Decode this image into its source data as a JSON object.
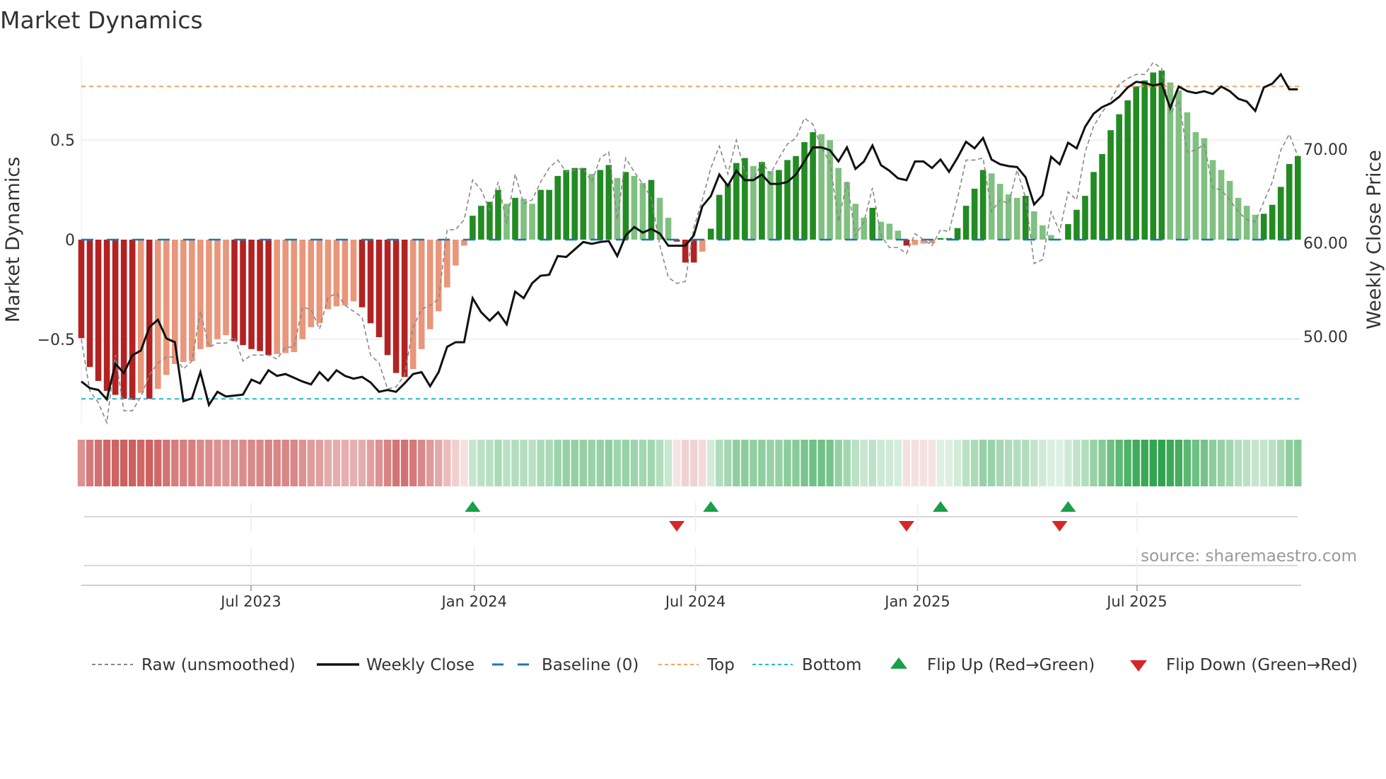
{
  "chart_data": {
    "type": "bar",
    "title": "Market Dynamics",
    "ylabel": "Market Dynamics",
    "ylabel_right": "Weekly Close Price",
    "ylim": [
      -0.92,
      0.92
    ],
    "ylim_right": [
      40.8,
      79.9
    ],
    "yticks": [
      {
        "v": 0.5,
        "label": "0.5"
      },
      {
        "v": 0,
        "label": "0"
      },
      {
        "v": -0.5,
        "label": "−0.5"
      }
    ],
    "yticks_right": [
      {
        "v": 70,
        "label": "70.00"
      },
      {
        "v": 60,
        "label": "60.00"
      },
      {
        "v": 50,
        "label": "50.00"
      }
    ],
    "xticks": [
      {
        "week": 20.95,
        "label": "Jul 2023"
      },
      {
        "week": 47.2,
        "label": "Jan 2024"
      },
      {
        "week": 73.2,
        "label": "Jul 2024"
      },
      {
        "week": 99.3,
        "label": "Jan 2025"
      },
      {
        "week": 125.1,
        "label": "Jul 2025"
      }
    ],
    "levels": {
      "top": 0.77,
      "bottom": -0.8,
      "baseline": 0
    },
    "colors": {
      "dark_red": "#b22222",
      "light_red": "#e9967a",
      "dark_green": "#228b22",
      "light_green": "#80c080",
      "raw": "#888888",
      "close": "#111111",
      "baseline": "#1f77b4",
      "top": "#f4a460",
      "bottom": "#17becf",
      "flip_up": "#1a9e4a",
      "flip_down": "#d62728"
    },
    "values": [
      -0.495,
      -0.64,
      -0.71,
      -0.76,
      -0.78,
      -0.8,
      -0.805,
      -0.77,
      -0.8,
      -0.75,
      -0.68,
      -0.625,
      -0.615,
      -0.61,
      -0.55,
      -0.54,
      -0.5,
      -0.48,
      -0.51,
      -0.53,
      -0.55,
      -0.56,
      -0.58,
      -0.575,
      -0.57,
      -0.565,
      -0.5,
      -0.44,
      -0.42,
      -0.35,
      -0.335,
      -0.33,
      -0.31,
      -0.34,
      -0.42,
      -0.49,
      -0.58,
      -0.67,
      -0.69,
      -0.65,
      -0.55,
      -0.45,
      -0.36,
      -0.24,
      -0.13,
      -0.03,
      0.12,
      0.17,
      0.19,
      0.25,
      0.18,
      0.21,
      0.205,
      0.18,
      0.25,
      0.25,
      0.32,
      0.35,
      0.36,
      0.36,
      0.33,
      0.35,
      0.375,
      0.31,
      0.34,
      0.32,
      0.285,
      0.3,
      0.21,
      0.11,
      -0.01,
      -0.115,
      -0.115,
      -0.06,
      0.055,
      0.225,
      0.28,
      0.385,
      0.41,
      0.37,
      0.39,
      0.345,
      0.35,
      0.4,
      0.42,
      0.49,
      0.54,
      0.53,
      0.5,
      0.36,
      0.29,
      0.18,
      0.11,
      0.16,
      0.09,
      0.08,
      0.045,
      -0.03,
      -0.027,
      -0.02,
      -0.018,
      0.008,
      0.008,
      0.058,
      0.17,
      0.256,
      0.35,
      0.333,
      0.28,
      0.227,
      0.21,
      0.22,
      0.142,
      0.072,
      0.023,
      0.004,
      0.078,
      0.15,
      0.22,
      0.34,
      0.43,
      0.55,
      0.63,
      0.7,
      0.77,
      0.8,
      0.84,
      0.85,
      0.79,
      0.75,
      0.64,
      0.54,
      0.51,
      0.4,
      0.35,
      0.295,
      0.21,
      0.17,
      0.125,
      0.13,
      0.175,
      0.265,
      0.38,
      0.42
    ],
    "raw": [
      -0.5,
      -0.76,
      -0.82,
      -0.92,
      -0.58,
      -0.86,
      -0.86,
      -0.79,
      -0.68,
      -0.62,
      -0.59,
      -0.59,
      -0.65,
      -0.61,
      -0.36,
      -0.54,
      -0.52,
      -0.52,
      -0.49,
      -0.61,
      -0.58,
      -0.58,
      -0.58,
      -0.6,
      -0.54,
      -0.54,
      -0.34,
      -0.35,
      -0.45,
      -0.29,
      -0.27,
      -0.33,
      -0.36,
      -0.39,
      -0.58,
      -0.62,
      -0.75,
      -0.74,
      -0.68,
      -0.44,
      -0.35,
      -0.33,
      -0.3,
      0.05,
      0.05,
      0.1,
      0.3,
      0.25,
      0.15,
      0.29,
      0.08,
      0.33,
      0.18,
      0.2,
      0.29,
      0.36,
      0.4,
      0.34,
      0.35,
      0.36,
      0.29,
      0.41,
      0.44,
      0.1,
      0.41,
      0.34,
      0.28,
      0.21,
      -0.03,
      -0.19,
      -0.22,
      -0.21,
      0.06,
      0.2,
      0.36,
      0.47,
      0.33,
      0.5,
      0.34,
      0.3,
      0.39,
      0.33,
      0.41,
      0.48,
      0.51,
      0.61,
      0.58,
      0.46,
      0.39,
      0.09,
      0.29,
      0.02,
      0.09,
      0.26,
      0.02,
      -0.04,
      -0.04,
      -0.07,
      0.03,
      0.0,
      -0.03,
      0.05,
      0.04,
      0.21,
      0.4,
      0.4,
      0.41,
      0.14,
      0.2,
      0.18,
      0.35,
      0.21,
      -0.12,
      -0.1,
      0.14,
      0.04,
      0.24,
      0.2,
      0.44,
      0.57,
      0.64,
      0.7,
      0.78,
      0.81,
      0.83,
      0.83,
      0.89,
      0.86,
      0.63,
      0.7,
      0.44,
      0.45,
      0.48,
      0.26,
      0.25,
      0.2,
      0.14,
      0.1,
      0.09,
      0.19,
      0.29,
      0.45,
      0.53,
      0.42
    ],
    "close": [
      45.2,
      44.5,
      44.3,
      43.3,
      47.1,
      46.1,
      48.0,
      48.5,
      51.0,
      51.8,
      49.8,
      49.4,
      43.1,
      43.4,
      46.2,
      42.7,
      44.1,
      43.6,
      43.7,
      43.8,
      45.4,
      45.0,
      46.4,
      45.8,
      46.0,
      45.6,
      45.2,
      44.9,
      46.2,
      45.3,
      46.4,
      45.8,
      45.5,
      45.7,
      45.1,
      44.1,
      44.3,
      44.1,
      45.0,
      46.0,
      46.2,
      44.7,
      46.2,
      48.9,
      49.4,
      49.4,
      54.1,
      52.6,
      51.7,
      52.6,
      51.3,
      54.8,
      54.1,
      55.7,
      56.5,
      56.6,
      58.6,
      58.5,
      59.3,
      60.1,
      59.9,
      60.1,
      60.2,
      58.6,
      60.8,
      61.7,
      61.1,
      61.5,
      61.0,
      59.7,
      59.7,
      59.7,
      60.8,
      63.9,
      65.0,
      67.3,
      66.1,
      67.7,
      66.7,
      66.7,
      67.3,
      66.3,
      66.3,
      66.5,
      67.3,
      68.7,
      70.2,
      70.2,
      69.9,
      68.7,
      70.2,
      67.9,
      68.7,
      70.4,
      68.3,
      67.7,
      66.9,
      66.7,
      68.7,
      68.7,
      68.0,
      68.9,
      67.6,
      69.1,
      70.8,
      70.1,
      71.2,
      68.9,
      68.4,
      68.2,
      68.1,
      67.0,
      64.1,
      65.1,
      69.2,
      68.4,
      70.7,
      70.1,
      72.4,
      73.8,
      74.5,
      74.9,
      75.6,
      76.6,
      77.2,
      77.1,
      76.8,
      77.0,
      74.4,
      76.7,
      76.2,
      76.0,
      76.2,
      75.9,
      76.7,
      76.2,
      75.4,
      75.1,
      74.1,
      76.6,
      77.0,
      78.0,
      76.4,
      76.4
    ],
    "flips": {
      "up_weeks": [
        47,
        75,
        102,
        117
      ],
      "down_weeks": [
        71,
        98,
        116
      ]
    },
    "legend": {
      "placement": "bottom",
      "items": [
        {
          "key": "raw",
          "label": "Raw (unsmoothed)"
        },
        {
          "key": "close",
          "label": "Weekly Close"
        },
        {
          "key": "baseline",
          "label": "Baseline (0)"
        },
        {
          "key": "top",
          "label": "Top"
        },
        {
          "key": "bottom",
          "label": "Bottom"
        },
        {
          "key": "flip_up",
          "label": "Flip Up (Red→Green)"
        },
        {
          "key": "flip_down",
          "label": "Flip Down (Green→Red)"
        }
      ]
    },
    "source": "source: sharemaestro.com"
  }
}
